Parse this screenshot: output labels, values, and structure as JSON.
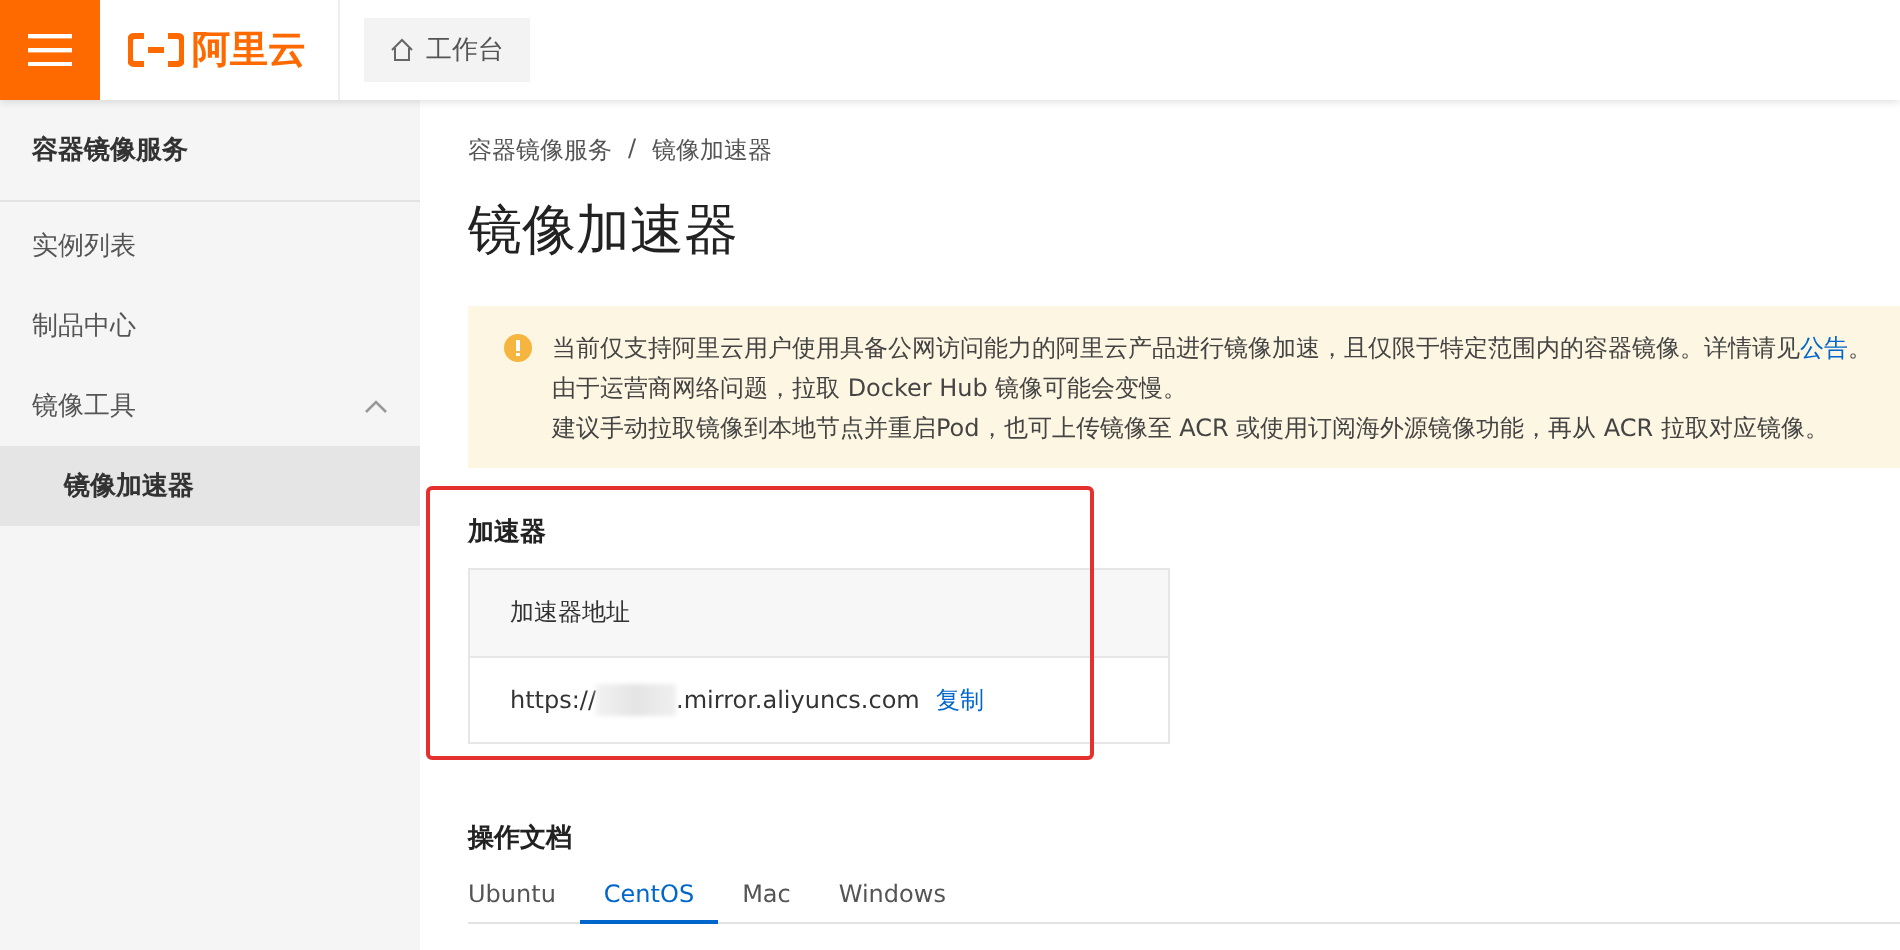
{
  "header": {
    "logo_text": "阿里云",
    "workbench": "工作台"
  },
  "sidebar": {
    "title": "容器镜像服务",
    "items": [
      {
        "label": "实例列表",
        "selected": false
      },
      {
        "label": "制品中心",
        "selected": false
      },
      {
        "label": "镜像工具",
        "selected": false,
        "expanded": true,
        "children": [
          {
            "label": "镜像加速器",
            "selected": true
          }
        ]
      }
    ]
  },
  "breadcrumb": [
    "容器镜像服务",
    "镜像加速器"
  ],
  "breadcrumb_separator": "/",
  "page_title": "镜像加速器",
  "notice": {
    "lines": [
      "当前仅支持阿里云用户使用具备公网访问能力的阿里云产品进行镜像加速，且仅限于特定范围内的容器镜像。详情请见",
      "由于运营商网络问题，拉取 Docker Hub 镜像可能会变慢。",
      "建议手动拉取镜像到本地节点并重启Pod，也可上传镜像至 ACR 或使用订阅海外源镜像功能，再从 ACR 拉取对应镜像。"
    ],
    "link": "公告",
    "link_end": "。"
  },
  "accelerator": {
    "title": "加速器",
    "highlighted": true,
    "column": "加速器地址",
    "url_prefix": "https://",
    "url_suffix": ".mirror.aliyuncs.com",
    "copy": "复制"
  },
  "docs": {
    "title": "操作文档",
    "tabs": [
      {
        "label": "Ubuntu",
        "selected": false
      },
      {
        "label": "CentOS",
        "selected": true
      },
      {
        "label": "Mac",
        "selected": false
      },
      {
        "label": "Windows",
        "selected": false
      }
    ]
  }
}
